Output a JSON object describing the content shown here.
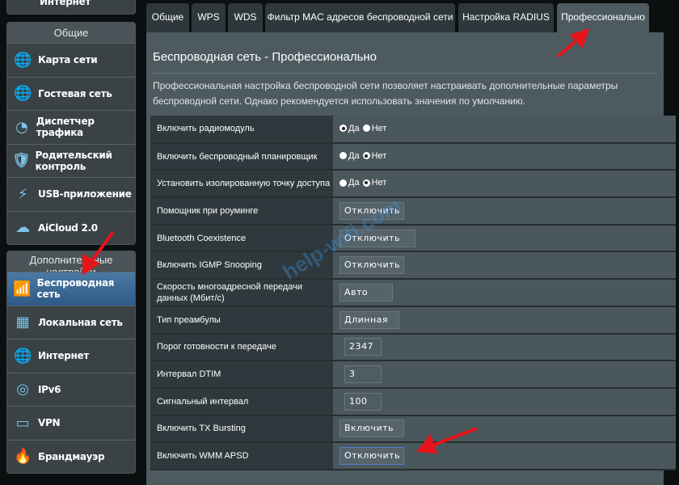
{
  "sidebar": {
    "top_partial_item": "Интернет",
    "general_header": "Общие",
    "general_items": [
      {
        "label": "Карта сети",
        "icon": "network-map-icon"
      },
      {
        "label": "Гостевая сеть",
        "icon": "guest-network-icon"
      },
      {
        "label": "Диспетчер трафика",
        "icon": "traffic-manager-icon"
      },
      {
        "label": "Родительский контроль",
        "icon": "parental-control-icon"
      },
      {
        "label": "USB-приложение",
        "icon": "usb-icon"
      },
      {
        "label": "AiCloud 2.0",
        "icon": "cloud-icon"
      }
    ],
    "advanced_header": "Дополнительные настройки",
    "advanced_items": [
      {
        "label": "Беспроводная сеть",
        "icon": "wireless-icon",
        "active": true
      },
      {
        "label": "Локальная сеть",
        "icon": "lan-icon"
      },
      {
        "label": "Интернет",
        "icon": "globe-icon"
      },
      {
        "label": "IPv6",
        "icon": "ipv6-icon"
      },
      {
        "label": "VPN",
        "icon": "vpn-icon"
      },
      {
        "label": "Брандмауэр",
        "icon": "firewall-icon"
      }
    ]
  },
  "tabs": [
    "Общие",
    "WPS",
    "WDS",
    "Фильтр MAC адресов беспроводной сети",
    "Настройка RADIUS",
    "Профессионально"
  ],
  "active_tab": "Профессионально",
  "main": {
    "title": "Беспроводная сеть - Профессионально",
    "description": "Профессиональная настройка беспроводной сети позволяет настраивать дополнительные параметры беспроводной сети. Однако рекомендуется использовать значения по умолчанию.",
    "yes": "Да",
    "no": "Нет",
    "rows": [
      {
        "label": "Включить радиомодуль",
        "type": "radio",
        "value": "Да"
      },
      {
        "label": "Включить беспроводный планировщик",
        "type": "radio",
        "value": "Нет"
      },
      {
        "label": "Установить изолированную точку доступа",
        "type": "radio",
        "value": "Нет"
      },
      {
        "label": "Помощник при роуминге",
        "type": "select",
        "value": "Отключить"
      },
      {
        "label": "Bluetooth Coexistence",
        "type": "select",
        "value": "Отключить"
      },
      {
        "label": "Включить IGMP Snooping",
        "type": "select",
        "value": "Отключить"
      },
      {
        "label": "Скорость многоадресной передачи данных (Мбит/с)",
        "type": "select",
        "value": "Авто"
      },
      {
        "label": "Тип преамбулы",
        "type": "select",
        "value": "Длинная"
      },
      {
        "label": "Порог готовности к передаче",
        "type": "input",
        "value": "2347"
      },
      {
        "label": "Интервал DTIM",
        "type": "input",
        "value": "3"
      },
      {
        "label": "Сигнальный интервал",
        "type": "input",
        "value": "100"
      },
      {
        "label": "Включить TX Bursting",
        "type": "select",
        "value": "Включить"
      },
      {
        "label": "Включить WMM APSD",
        "type": "select",
        "value": "Отключить"
      }
    ]
  },
  "watermark": "help-wifi.com",
  "colors": {
    "accent": "#2d5a86",
    "arrow": "#e8141b"
  }
}
